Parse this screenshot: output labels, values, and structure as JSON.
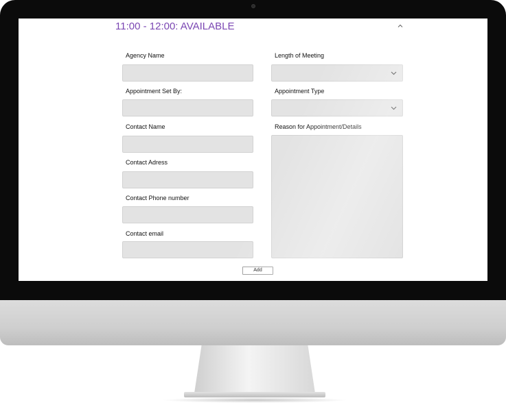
{
  "slot": {
    "title": "11:00 - 12:00: AVAILABLE"
  },
  "form": {
    "left_fields": [
      {
        "label": "Agency Name",
        "value": ""
      },
      {
        "label": "Appointment Set By:",
        "value": ""
      },
      {
        "label": "Contact Name",
        "value": ""
      },
      {
        "label": "Contact Adress",
        "value": ""
      },
      {
        "label": "Contact Phone number",
        "value": ""
      },
      {
        "label": "Contact email",
        "value": ""
      }
    ],
    "right_fields": {
      "length": {
        "label": "Length of Meeting",
        "value": ""
      },
      "type": {
        "label": "Appointment Type",
        "value": ""
      },
      "reason": {
        "label": "Reason for Appointment/Details",
        "value": ""
      }
    },
    "add_label": "Add"
  },
  "colors": {
    "title_accent": "#7b47b3",
    "input_fill": "#e3e3e3",
    "input_border": "#d2d2d2",
    "bezel": "#0b0b0b",
    "chassis": "#cfcfcf"
  },
  "icons": {
    "collapse": "chevron-up-icon",
    "select": "chevron-down-icon"
  }
}
